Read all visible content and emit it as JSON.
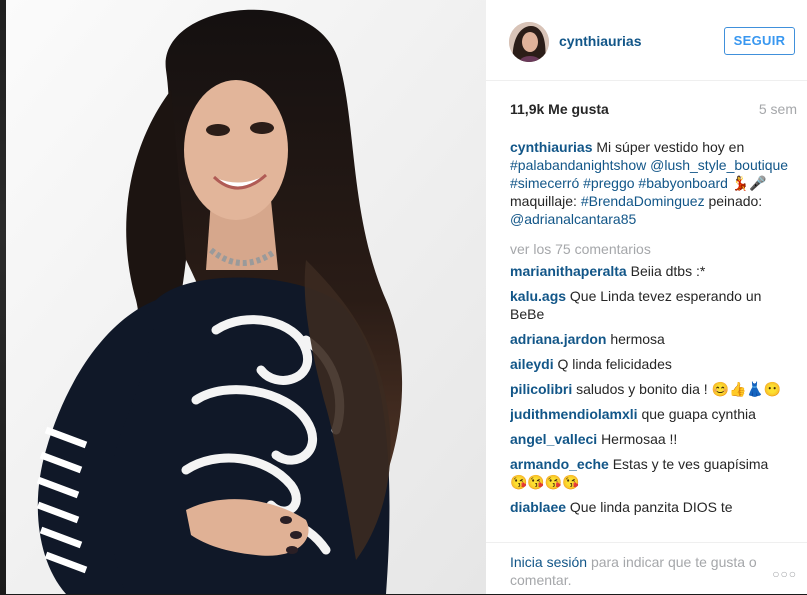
{
  "post": {
    "username": "cynthiaurias",
    "follow_label": "SEGUIR",
    "likes": "11,9k Me gusta",
    "time_ago": "5 sem"
  },
  "caption": {
    "user": "cynthiaurias",
    "text_1": "Mi súper vestido hoy en",
    "tag_1": "#palabandanightshow",
    "mention_1": "@lush_style_boutique",
    "tag_2": "#simecerró",
    "tag_3": "#preggo",
    "tag_4": "#babyonboard",
    "emoji_1": "💃🎤",
    "text_2": "maquillaje:",
    "tag_5": "#BrendaDominguez",
    "text_3": "peinado:",
    "mention_2": "@adrianalcantara85"
  },
  "view_comments": "ver los 75 comentarios",
  "comments": [
    {
      "user": "marianithaperalta",
      "text": "Beiia dtbs :*"
    },
    {
      "user": "kalu.ags",
      "text": "Que Linda tevez esperando un BeBe"
    },
    {
      "user": "adriana.jardon",
      "text": "hermosa"
    },
    {
      "user": "aileydi",
      "text": "Q linda felicidades"
    },
    {
      "user": "pilicolibri",
      "text": "saludos y bonito dia !",
      "emoji": "😊👍👗😶"
    },
    {
      "user": "judithmendiolamxli",
      "text": "que guapa cynthia"
    },
    {
      "user": "angel_valleci",
      "text": "Hermosaa !!"
    },
    {
      "user": "armando_eche",
      "text": "Estas y te ves guapísima",
      "emoji": "😘😘😘😘"
    },
    {
      "user": "diablaee",
      "text": "Que linda panzita DIOS te"
    }
  ],
  "footer": {
    "login_link": "Inicia sesión",
    "login_text": "para indicar que te gusta o comentar.",
    "more_icon": "ellipsis-icon"
  },
  "colors": {
    "link": "#125688",
    "button": "#3897f0",
    "muted": "#a5a7aa"
  }
}
